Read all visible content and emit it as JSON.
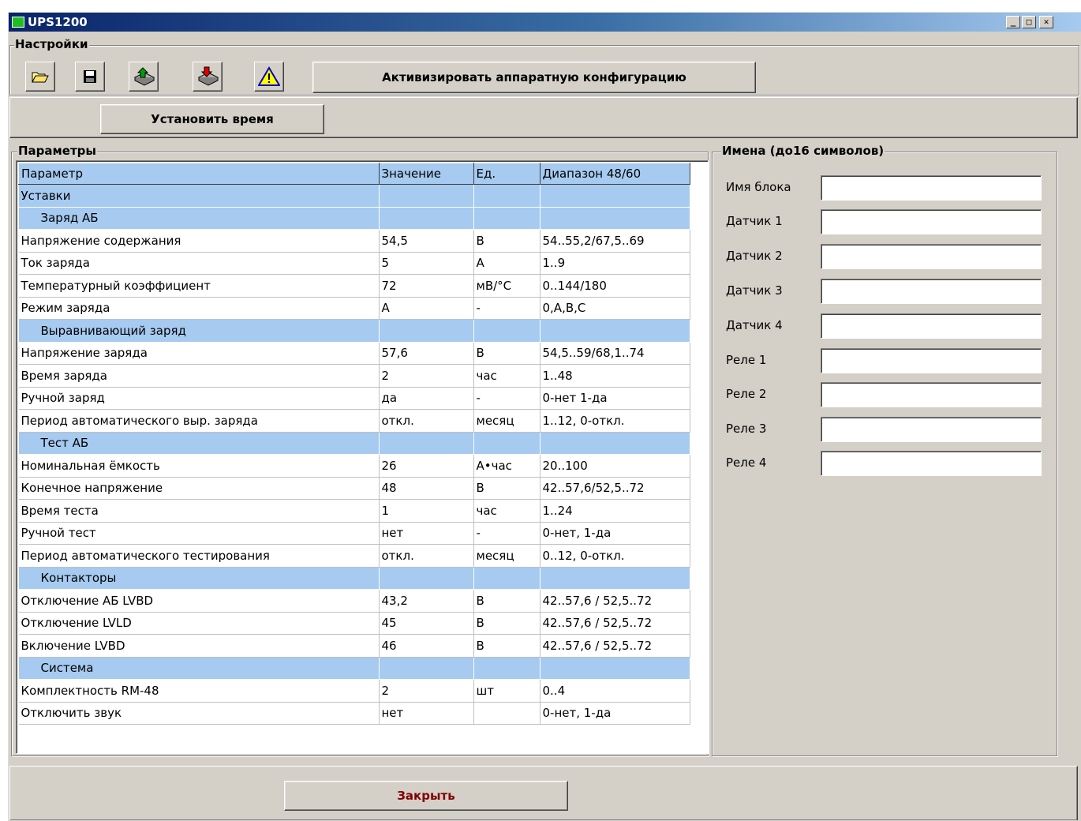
{
  "window": {
    "title": "UPS1200",
    "minimize": "_",
    "maximize": "□",
    "close": "✕"
  },
  "settings": {
    "legend": "Настройки",
    "activate_label": "Активизировать аппаратную конфигурацию",
    "set_time_label": "Установить время"
  },
  "params": {
    "legend": "Параметры",
    "headers": [
      "Параметр",
      "Значение",
      "Ед.",
      "Диапазон 48/60"
    ],
    "rows": [
      {
        "type": "section",
        "name": "Уставки"
      },
      {
        "type": "section",
        "name": "Заряд АБ",
        "indent": true
      },
      {
        "type": "row",
        "name": "Напряжение содержания",
        "value": "54,5",
        "unit": "В",
        "range": "54..55,2/67,5..69"
      },
      {
        "type": "row",
        "name": "Ток заряда",
        "value": "5",
        "unit": "А",
        "range": "1..9"
      },
      {
        "type": "row",
        "name": "Температурный коэффициент",
        "value": "72",
        "unit": "мВ/°С",
        "range": "0..144/180"
      },
      {
        "type": "row",
        "name": "Режим заряда",
        "value": "A",
        "unit": "-",
        "range": "0,A,B,C"
      },
      {
        "type": "section",
        "name": "Выравнивающий заряд",
        "indent": true
      },
      {
        "type": "row",
        "name": "Напряжение заряда",
        "value": "57,6",
        "unit": "В",
        "range": "54,5..59/68,1..74"
      },
      {
        "type": "row",
        "name": "Время заряда",
        "value": "2",
        "unit": "час",
        "range": "1..48"
      },
      {
        "type": "row",
        "name": "Ручной заряд",
        "value": "да",
        "unit": "-",
        "range": "0-нет 1-да"
      },
      {
        "type": "row",
        "name": "Период автоматического выр. заряда",
        "value": "откл.",
        "unit": "месяц",
        "range": "1..12, 0-откл."
      },
      {
        "type": "section",
        "name": "Тест АБ",
        "indent": true
      },
      {
        "type": "row",
        "name": "Номинальная ёмкость",
        "value": "26",
        "unit": "А•час",
        "range": "20..100"
      },
      {
        "type": "row",
        "name": "Конечное напряжение",
        "value": "48",
        "unit": "В",
        "range": "42..57,6/52,5..72"
      },
      {
        "type": "row",
        "name": "Время теста",
        "value": "1",
        "unit": "час",
        "range": "1..24"
      },
      {
        "type": "row",
        "name": "Ручной тест",
        "value": "нет",
        "unit": "-",
        "range": "0-нет, 1-да"
      },
      {
        "type": "row",
        "name": "Период автоматического тестирования",
        "value": "откл.",
        "unit": "месяц",
        "range": "0..12, 0-откл."
      },
      {
        "type": "section",
        "name": "Контакторы",
        "indent": true
      },
      {
        "type": "row",
        "name": "Отключение АБ LVBD",
        "value": "43,2",
        "unit": "В",
        "range": "42..57,6 / 52,5..72"
      },
      {
        "type": "row",
        "name": "Отключение LVLD",
        "value": "45",
        "unit": "В",
        "range": "42..57,6 / 52,5..72"
      },
      {
        "type": "row",
        "name": "Включение LVBD",
        "value": "46",
        "unit": "В",
        "range": "42..57,6 / 52,5..72"
      },
      {
        "type": "section",
        "name": "Система",
        "indent": true
      },
      {
        "type": "row",
        "name": "Комплектность RM-48",
        "value": "2",
        "unit": "шт",
        "range": "0..4"
      },
      {
        "type": "row",
        "name": "Отключить звук",
        "value": "нет",
        "unit": "",
        "range": "0-нет, 1-да"
      }
    ]
  },
  "names": {
    "legend": "Имена (до16 символов)",
    "fields": [
      {
        "label": "Имя блока",
        "value": ""
      },
      {
        "label": "Датчик 1",
        "value": ""
      },
      {
        "label": "Датчик 2",
        "value": ""
      },
      {
        "label": "Датчик 3",
        "value": ""
      },
      {
        "label": "Датчик 4",
        "value": ""
      },
      {
        "label": "Реле 1",
        "value": ""
      },
      {
        "label": "Реле 2",
        "value": ""
      },
      {
        "label": "Реле 3",
        "value": ""
      },
      {
        "label": "Реле 4",
        "value": ""
      }
    ]
  },
  "footer": {
    "close_label": "Закрыть",
    "close_color": "#800000"
  },
  "colors": {
    "title_gradient_start": "#0a246a",
    "face": "#d4d0c8",
    "row_highlight": "#a6caf0"
  }
}
